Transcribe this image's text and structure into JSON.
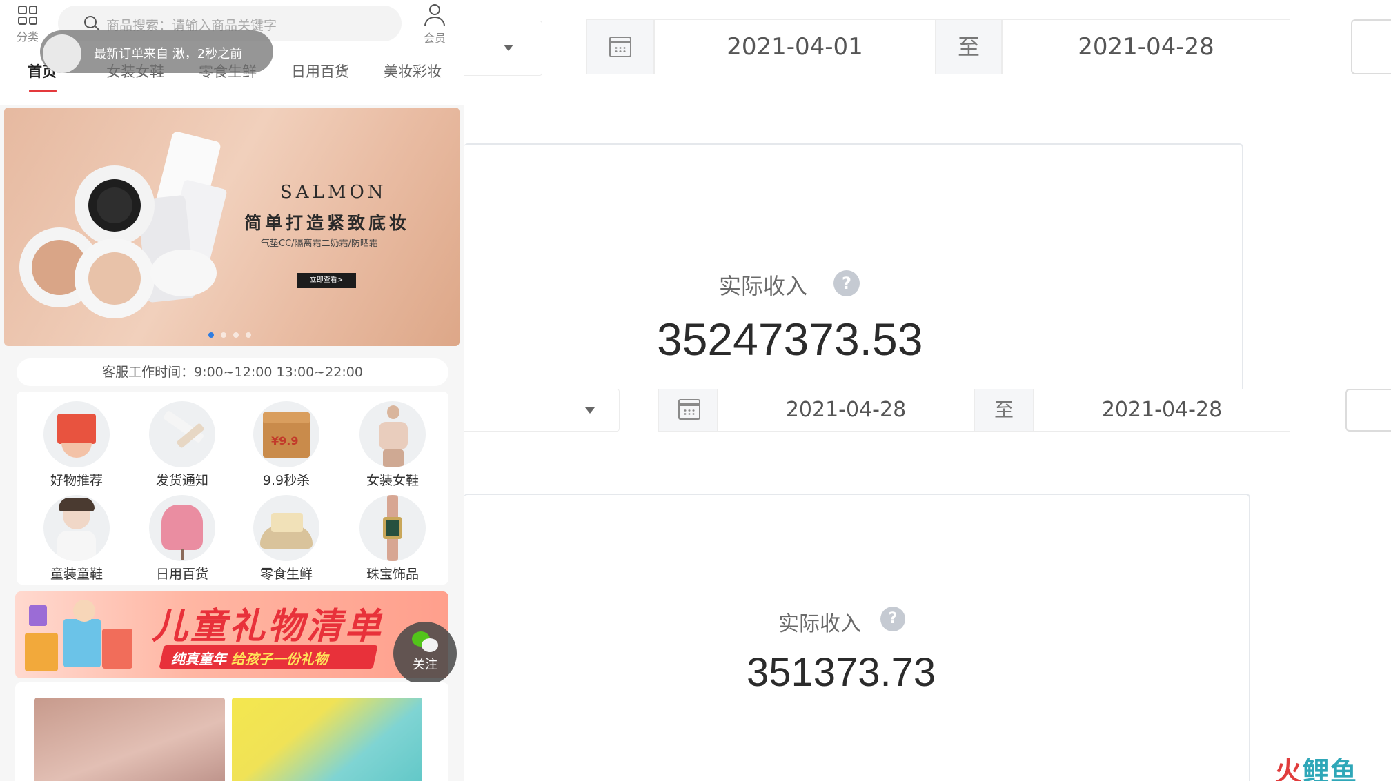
{
  "mobile": {
    "top": {
      "category_label": "分类",
      "search_placeholder": "商品搜索：请输入商品关键字",
      "member_label": "会员",
      "toast": "最新订单来自 湫，2秒之前"
    },
    "tabs": [
      {
        "label": "首页",
        "active": true
      },
      {
        "label": "女装女鞋"
      },
      {
        "label": "零食生鲜"
      },
      {
        "label": "日用百货"
      },
      {
        "label": "美妆彩妆"
      }
    ],
    "banner": {
      "brand": "SALMON",
      "slogan": "简单打造紧致底妆",
      "sub": "气垫CC/隔离霜二奶霜/防晒霜",
      "cta": "立即查看>",
      "slides": 4,
      "active_slide": 1
    },
    "service_hours": "客服工作时间：9:00~12:00  13:00~22:00",
    "categories": [
      {
        "label": "好物推荐",
        "icon": "gift-box-icon"
      },
      {
        "label": "发货通知",
        "icon": "paper-plane-icon"
      },
      {
        "label": "9.9秒杀",
        "icon": "parcel-box-icon"
      },
      {
        "label": "女装女鞋",
        "icon": "womens-wear-icon"
      },
      {
        "label": "童装童鞋",
        "icon": "kids-wear-icon"
      },
      {
        "label": "日用百货",
        "icon": "umbrella-icon"
      },
      {
        "label": "零食生鲜",
        "icon": "snack-icon"
      },
      {
        "label": "珠宝饰品",
        "icon": "watch-icon"
      }
    ],
    "promo": {
      "title": "儿童礼物清单",
      "tagline_a": "纯真童年",
      "tagline_b": "给孩子一份礼物"
    },
    "follow_label": "关注"
  },
  "dashboard": {
    "panels": [
      {
        "date_from": "2021-04-01",
        "separator": "至",
        "date_to": "2021-04-28",
        "metric_label": "实际收入",
        "metric_value": "35247373.53"
      },
      {
        "date_from": "2021-04-28",
        "separator": "至",
        "date_to": "2021-04-28",
        "metric_label": "实际收入",
        "metric_value": "351373.73"
      }
    ],
    "help_glyph": "?"
  },
  "watermark": {
    "part_a": "火",
    "part_b": "鲤鱼"
  },
  "colors": {
    "accent_red": "#e4393c",
    "slide_dot": "#2f7de1"
  }
}
